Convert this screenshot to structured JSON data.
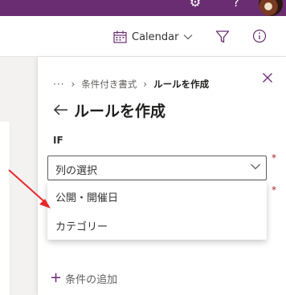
{
  "topbar": {
    "settings_icon": "gear-icon",
    "help_label": "?",
    "avatar": "user-avatar"
  },
  "command_bar": {
    "calendar_label": "Calendar"
  },
  "panel": {
    "breadcrumb": {
      "ellipsis": "···",
      "parent": "条件付き書式",
      "current": "ルールを作成"
    },
    "title": "ルールを作成",
    "if_label": "IF",
    "column_select": {
      "value": "列の選択",
      "required_mark": "*"
    },
    "second_required_mark": "*",
    "dropdown_options": [
      "公開・開催日",
      "カテゴリー"
    ],
    "add_condition_label": "条件の追加"
  },
  "colors": {
    "suite_bar": "#6a2d72",
    "accent": "#6a2d72",
    "annotation_arrow": "#e8282b"
  }
}
